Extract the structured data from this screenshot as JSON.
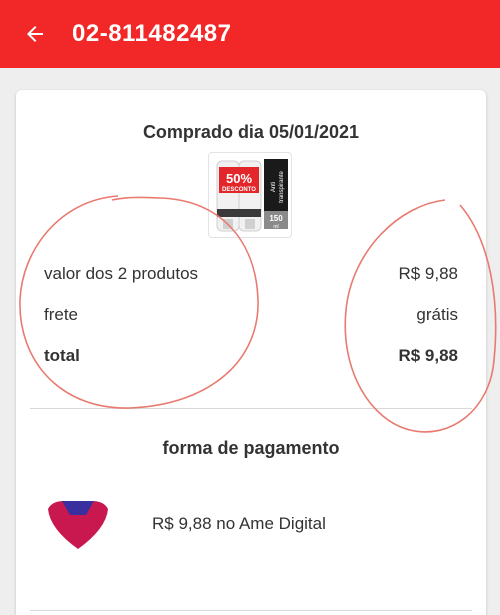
{
  "header": {
    "title": "02-811482487",
    "back_icon": "arrow-left-icon",
    "background": "#f22828"
  },
  "order": {
    "date_label": "Comprado dia 05/01/2021",
    "product_image": {
      "badge_top": "50%",
      "badge_bottom": "DESCONTO",
      "side_text_1": "Anti",
      "side_text_2": "transpirante",
      "size": "150",
      "unit": "ml"
    }
  },
  "summary": [
    {
      "label": "valor dos 2 produtos",
      "value": "R$ 9,88"
    },
    {
      "label": "frete",
      "value": "grátis"
    },
    {
      "label": "total",
      "value": "R$ 9,88"
    }
  ],
  "payment": {
    "title": "forma de pagamento",
    "method_text": "R$ 9,88 no Ame Digital",
    "logo_icon": "ame-digital-logo"
  },
  "colors": {
    "accent": "#f22828",
    "annotation": "#e87a70"
  }
}
